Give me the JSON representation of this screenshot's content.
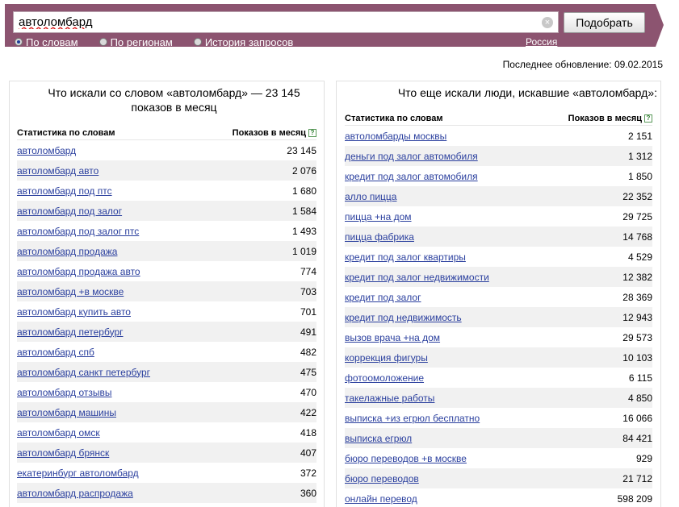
{
  "search": {
    "query": "автоломбард",
    "clear_glyph": "×",
    "submit_label": "Подобрать",
    "modes": [
      {
        "label": "По словам",
        "selected": true
      },
      {
        "label": "По регионам",
        "selected": false
      },
      {
        "label": "История запросов",
        "selected": false
      }
    ],
    "region": "Россия"
  },
  "last_update": "Последнее обновление: 09.02.2015",
  "left_panel": {
    "title": "Что искали со словом «автоломбард» — 23 145 показов в месяц",
    "col_keyword": "Статистика по словам",
    "col_count": "Показов в месяц",
    "help_glyph": "?",
    "rows": [
      {
        "kw": "автоломбард",
        "cnt": "23 145"
      },
      {
        "kw": "автоломбард авто",
        "cnt": "2 076"
      },
      {
        "kw": "автоломбард под птс",
        "cnt": "1 680"
      },
      {
        "kw": "автоломбард под залог",
        "cnt": "1 584"
      },
      {
        "kw": "автоломбард под залог птс",
        "cnt": "1 493"
      },
      {
        "kw": "автоломбард продажа",
        "cnt": "1 019"
      },
      {
        "kw": "автоломбард продажа авто",
        "cnt": "774"
      },
      {
        "kw": "автоломбард +в москве",
        "cnt": "703"
      },
      {
        "kw": "автоломбард купить авто",
        "cnt": "701"
      },
      {
        "kw": "автоломбард петербург",
        "cnt": "491"
      },
      {
        "kw": "автоломбард спб",
        "cnt": "482"
      },
      {
        "kw": "автоломбард санкт петербург",
        "cnt": "475"
      },
      {
        "kw": "автоломбард отзывы",
        "cnt": "470"
      },
      {
        "kw": "автоломбард машины",
        "cnt": "422"
      },
      {
        "kw": "автоломбард омск",
        "cnt": "418"
      },
      {
        "kw": "автоломбард брянск",
        "cnt": "407"
      },
      {
        "kw": "екатеринбург автоломбард",
        "cnt": "372"
      },
      {
        "kw": "автоломбард распродажа",
        "cnt": "360"
      }
    ]
  },
  "right_panel": {
    "title": "Что еще искали люди, искавшие «автоломбард»:",
    "col_keyword": "Статистика по словам",
    "col_count": "Показов в месяц",
    "help_glyph": "?",
    "rows": [
      {
        "kw": "автоломбарды москвы",
        "cnt": "2 151"
      },
      {
        "kw": "деньги под залог автомобиля",
        "cnt": "1 312"
      },
      {
        "kw": "кредит под залог автомобиля",
        "cnt": "1 850"
      },
      {
        "kw": "алло пицца",
        "cnt": "22 352"
      },
      {
        "kw": "пицца +на дом",
        "cnt": "29 725"
      },
      {
        "kw": "пицца фабрика",
        "cnt": "14 768"
      },
      {
        "kw": "кредит под залог квартиры",
        "cnt": "4 529"
      },
      {
        "kw": "кредит под залог недвижимости",
        "cnt": "12 382"
      },
      {
        "kw": "кредит под залог",
        "cnt": "28 369"
      },
      {
        "kw": "кредит под недвижимость",
        "cnt": "12 943"
      },
      {
        "kw": "вызов врача +на дом",
        "cnt": "29 573"
      },
      {
        "kw": "коррекция фигуры",
        "cnt": "10 103"
      },
      {
        "kw": "фотоомоложение",
        "cnt": "6 115"
      },
      {
        "kw": "такелажные работы",
        "cnt": "4 850"
      },
      {
        "kw": "выписка +из егрюл бесплатно",
        "cnt": "16 066"
      },
      {
        "kw": "выписка егрюл",
        "cnt": "84 421"
      },
      {
        "kw": "бюро переводов +в москве",
        "cnt": "929"
      },
      {
        "kw": "бюро переводов",
        "cnt": "21 712"
      },
      {
        "kw": "онлайн перевод",
        "cnt": "598 209"
      }
    ]
  }
}
